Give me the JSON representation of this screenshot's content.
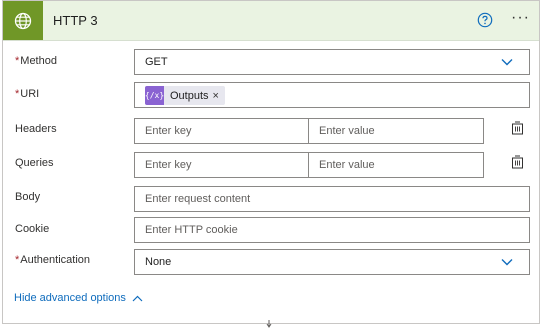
{
  "header": {
    "title": "HTTP 3",
    "icon": "globe-icon",
    "help_icon": "help-circle-icon",
    "more_label": "···",
    "accent_color": "#709727",
    "header_bg": "#eaf3e2"
  },
  "fields": {
    "method": {
      "label": "Method",
      "required_mark": "*",
      "value": "GET"
    },
    "uri": {
      "label": "URI",
      "required_mark": "*",
      "token": {
        "icon_text": "{/x}",
        "label": "Outputs",
        "close": "×"
      }
    },
    "headers": {
      "label": "Headers",
      "key_placeholder": "Enter key",
      "value_placeholder": "Enter value"
    },
    "queries": {
      "label": "Queries",
      "key_placeholder": "Enter key",
      "value_placeholder": "Enter value"
    },
    "body": {
      "label": "Body",
      "placeholder": "Enter request content"
    },
    "cookie": {
      "label": "Cookie",
      "placeholder": "Enter HTTP cookie"
    },
    "authentication": {
      "label": "Authentication",
      "required_mark": "*",
      "value": "None"
    }
  },
  "advanced": {
    "label": "Hide advanced options"
  },
  "colors": {
    "link": "#0f6cbd",
    "required": "#a4262c",
    "token_icon": "#8a63d2"
  }
}
